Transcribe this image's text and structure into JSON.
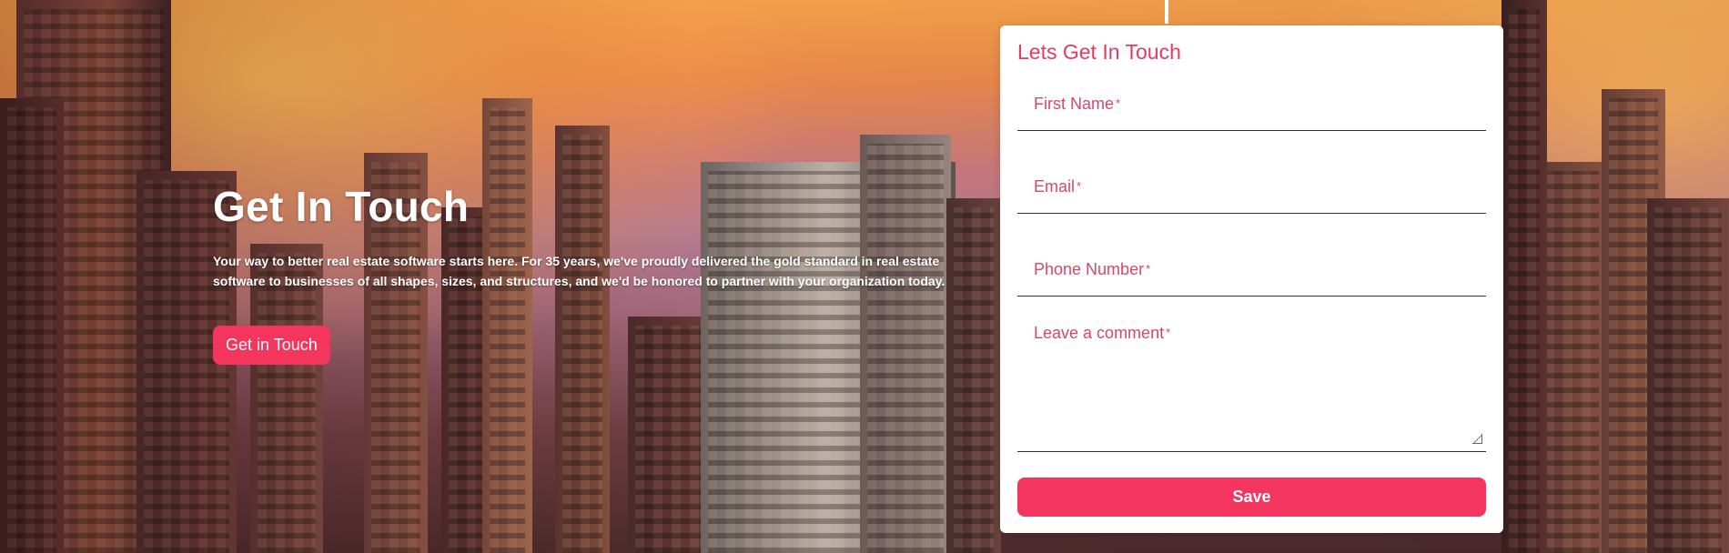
{
  "hero": {
    "title": "Get In Touch",
    "description": "Your way to better real estate software starts here. For 35 years, we've proudly delivered the gold standard in real estate software to businesses of all shapes, sizes, and structures, and we'd be honored to partner with your organization today.",
    "cta_label": "Get in Touch"
  },
  "form": {
    "title": "Lets Get In Touch",
    "first_name_label": "First Name",
    "email_label": "Email",
    "phone_label": "Phone Number",
    "comment_label": "Leave a comment",
    "required_marker": "*",
    "save_label": "Save"
  },
  "colors": {
    "accent": "#f4365f",
    "label": "#d6476a"
  }
}
